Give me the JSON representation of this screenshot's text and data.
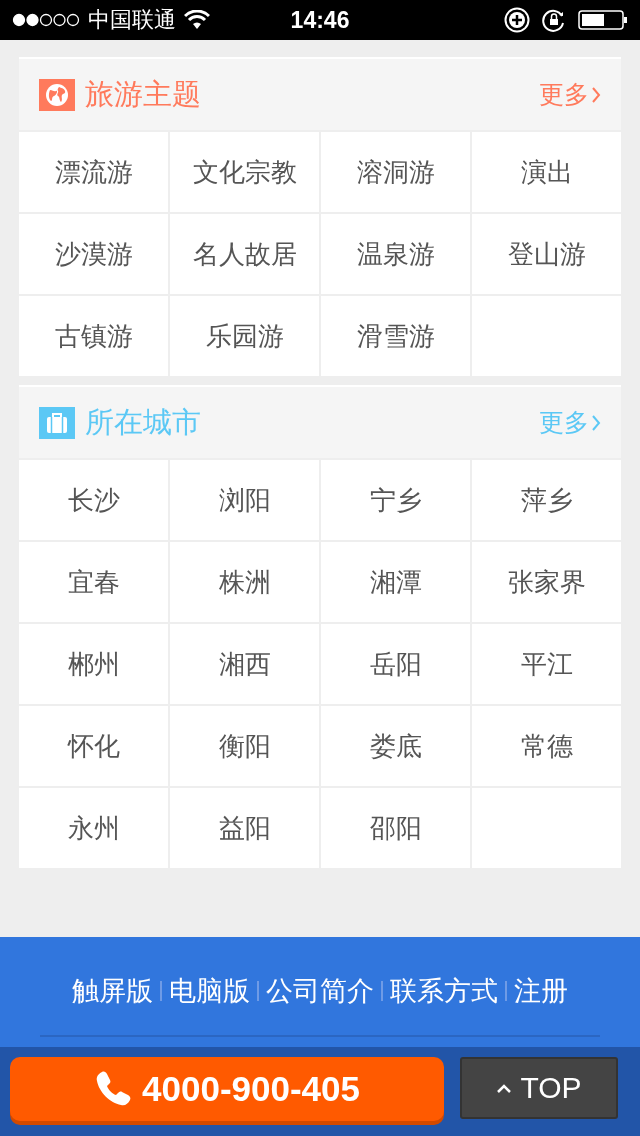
{
  "status_bar": {
    "carrier": "中国联通",
    "time": "14:46"
  },
  "sections": [
    {
      "title": "旅游主题",
      "more": "更多",
      "color": "#ff7a5c",
      "items": [
        "漂流游",
        "文化宗教",
        "溶洞游",
        "演出",
        "沙漠游",
        "名人故居",
        "温泉游",
        "登山游",
        "古镇游",
        "乐园游",
        "滑雪游"
      ]
    },
    {
      "title": "所在城市",
      "more": "更多",
      "color": "#5bc8f5",
      "items": [
        "长沙",
        "浏阳",
        "宁乡",
        "萍乡",
        "宜春",
        "株洲",
        "湘潭",
        "张家界",
        "郴州",
        "湘西",
        "岳阳",
        "平江",
        "怀化",
        "衡阳",
        "娄底",
        "常德",
        "永州",
        "益阳",
        "邵阳"
      ]
    }
  ],
  "footer": {
    "links": [
      "触屏版",
      "电脑版",
      "公司简介",
      "联系方式",
      "注册"
    ]
  },
  "call_button": {
    "label": "4000-900-405"
  },
  "top_button": {
    "label": "TOP"
  }
}
